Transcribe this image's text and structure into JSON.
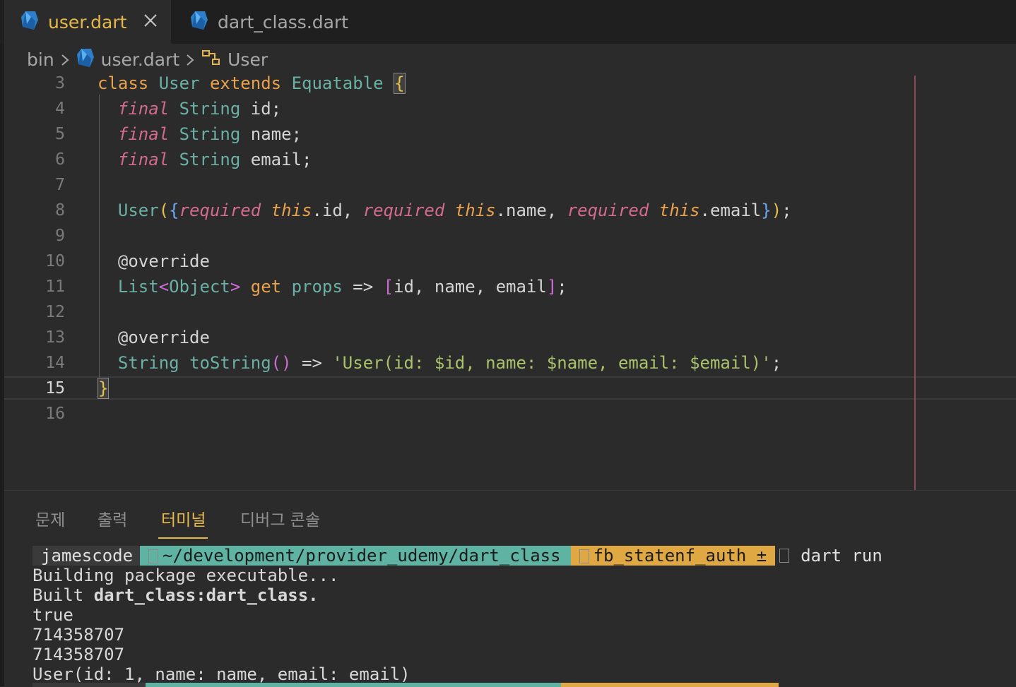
{
  "tabs": [
    {
      "label": "user.dart",
      "active": true
    },
    {
      "label": "dart_class.dart",
      "active": false
    }
  ],
  "breadcrumb": {
    "folder": "bin",
    "file": "user.dart",
    "symbol": "User"
  },
  "editor": {
    "line_numbers": [
      "3",
      "4",
      "5",
      "6",
      "7",
      "8",
      "9",
      "10",
      "11",
      "12",
      "13",
      "14",
      "15",
      "16"
    ],
    "current_line": "15",
    "lines": {
      "l3": {
        "class": "class",
        "name": "User",
        "extends": "extends",
        "super": "Equatable",
        "brace": "{"
      },
      "l4": {
        "mod": "final",
        "type": "String",
        "rest": "id;"
      },
      "l5": {
        "mod": "final",
        "type": "String",
        "rest": "name;"
      },
      "l6": {
        "mod": "final",
        "type": "String",
        "rest": "email;"
      },
      "l8": {
        "ctor": "User",
        "p1": "(",
        "p2": "{",
        "req": "required",
        "this": "this",
        "id": ".id, ",
        "name": ".name, ",
        "email": ".email",
        "p3": "}",
        "p4": ")",
        "end": ";"
      },
      "l10": {
        "anno": "@override"
      },
      "l11": {
        "list": "List",
        "lt": "<",
        "obj": "Object",
        "gt": ">",
        "get": "get",
        "props": "props",
        "arrow": " => ",
        "lb": "[",
        "items": "id, name, email",
        "rb": "]",
        "end": ";"
      },
      "l13": {
        "anno": "@override"
      },
      "l14": {
        "type": "String",
        "fn": "toString",
        "parens": "()",
        "arrow": " => ",
        "str": "'User(id: $id, name: $name, email: $email)'",
        "end": ";"
      },
      "l15": {
        "brace": "}"
      }
    }
  },
  "panel": {
    "tabs": [
      "문제",
      "출력",
      "터미널",
      "디버그 콘솔"
    ],
    "active_tab": "터미널"
  },
  "terminal": {
    "user": "jamescode",
    "path": "~/development/provider_udemy/dart_class",
    "branch": "fb_statenf_auth ±",
    "command": "dart run",
    "out1": "Building package executable...",
    "out2_prefix": "Built ",
    "out2_bold": "dart_class:dart_class.",
    "out3": "true",
    "out4": "714358707",
    "out5": "714358707",
    "out6": "User(id: 1, name: name, email: email)"
  },
  "colors": {
    "accent": "#e6b84a",
    "path_segment": "#5fb3a3",
    "git_segment": "#e0a843",
    "dart_icon": "#2e7fc9"
  }
}
